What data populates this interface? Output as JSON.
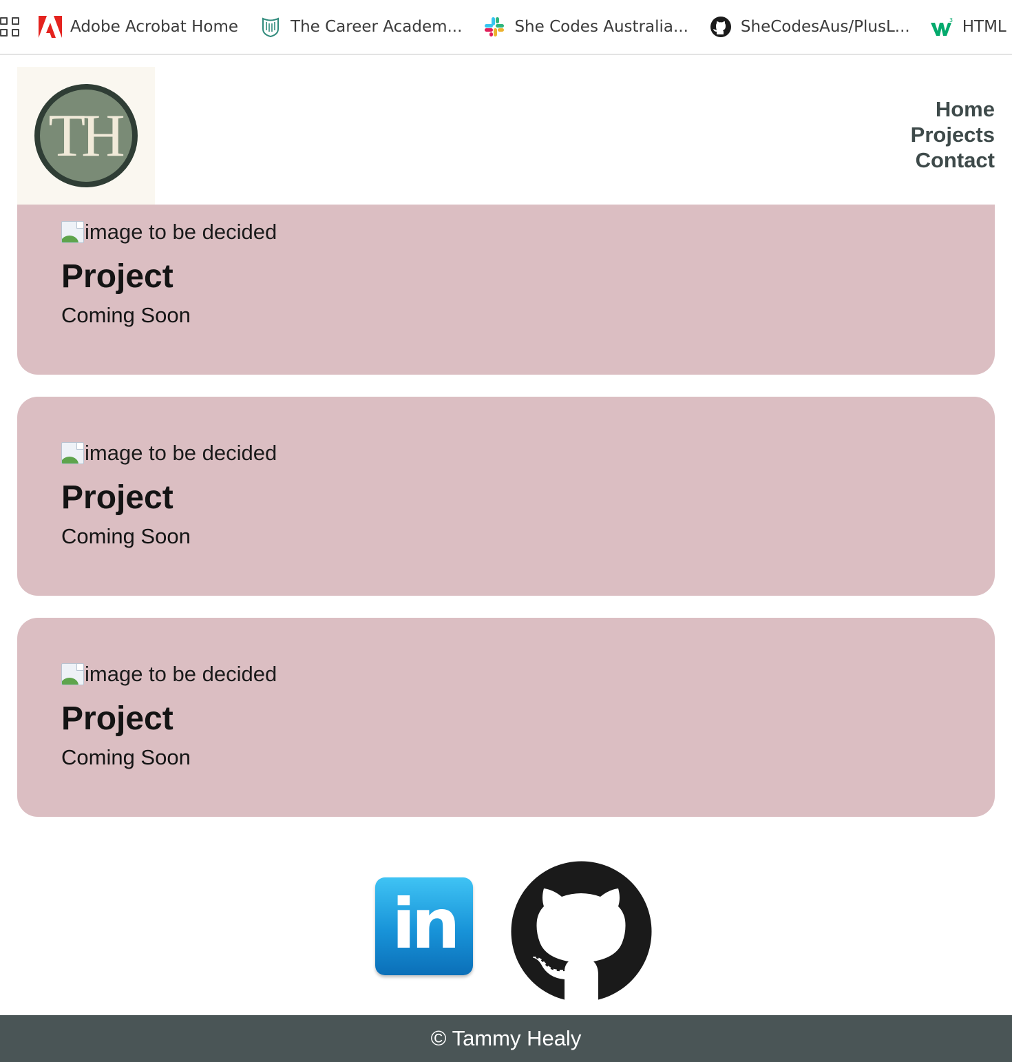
{
  "bookmarks_bar": {
    "apps_icon": "apps-grid-icon",
    "items": [
      {
        "label": "Adobe Acrobat Home",
        "icon": "adobe-acrobat-icon"
      },
      {
        "label": "The Career Academ...",
        "icon": "career-academy-icon"
      },
      {
        "label": "She Codes Australia...",
        "icon": "slack-icon"
      },
      {
        "label": "SheCodesAus/PlusL...",
        "icon": "github-icon"
      },
      {
        "label": "HTML (",
        "icon": "w3schools-icon"
      }
    ]
  },
  "header": {
    "logo_text": "TH",
    "nav": [
      {
        "label": "Home"
      },
      {
        "label": "Projects"
      },
      {
        "label": "Contact"
      }
    ]
  },
  "projects": [
    {
      "image_alt": "image to be decided",
      "title": "Project",
      "subtitle": "Coming Soon"
    },
    {
      "image_alt": "image to be decided",
      "title": "Project",
      "subtitle": "Coming Soon"
    },
    {
      "image_alt": "image to be decided",
      "title": "Project",
      "subtitle": "Coming Soon"
    }
  ],
  "social": {
    "linkedin_icon": "linkedin-icon",
    "linkedin_text": "in",
    "github_icon": "github-icon"
  },
  "footer": {
    "text": "© Tammy Healy"
  },
  "colors": {
    "card_bg": "#dbbec2",
    "footer_bg": "#4a5556",
    "nav_text": "#3e4a4a",
    "logo_bg": "#faf7f0",
    "logo_circle": "#7a8b76"
  }
}
